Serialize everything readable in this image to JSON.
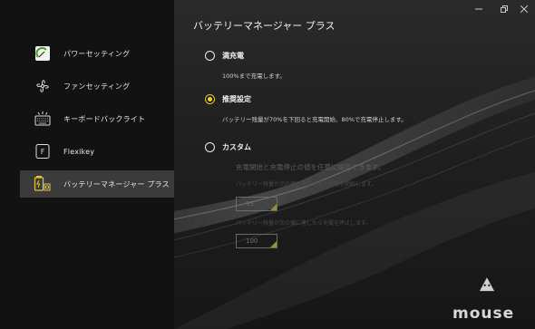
{
  "window": {
    "title": "バッテリーマネージャー プラス",
    "controls": [
      "minimize",
      "restore",
      "close"
    ]
  },
  "sidebar": {
    "items": [
      {
        "label": "パワーセッティング",
        "icon": "power-meter-icon",
        "active": false
      },
      {
        "label": "ファンセッティング",
        "icon": "fan-icon",
        "active": false
      },
      {
        "label": "キーボードバックライト",
        "icon": "keyboard-backlight-icon",
        "active": false
      },
      {
        "label": "Flexikey",
        "icon": "flexikey-icon",
        "active": false
      },
      {
        "label": "バッテリーマネージャー プラス",
        "icon": "battery-manager-icon",
        "active": true
      }
    ]
  },
  "options": [
    {
      "label": "満充電",
      "desc": "100%まで充電します。",
      "selected": false
    },
    {
      "label": "推奨設定",
      "desc": "バッテリー残量が70%を下回ると充電開始、80%で充電停止します。",
      "selected": true
    },
    {
      "label": "カスタム",
      "desc": "充電開始と充電停止の値を任意に設定できます。",
      "selected": false
    }
  ],
  "custom": {
    "start_label": "バッテリー残量が次の値を下回ったら充電を開始します。",
    "start_value": "95",
    "stop_label": "バッテリー残量が次の値に達したら充電を停止します。",
    "stop_value": "100"
  },
  "brand": {
    "logo_text": "mouse"
  },
  "colors": {
    "accent": "#f0cf3e",
    "sidebar_bg": "#121212",
    "active_item_bg": "#3b3b3b"
  }
}
